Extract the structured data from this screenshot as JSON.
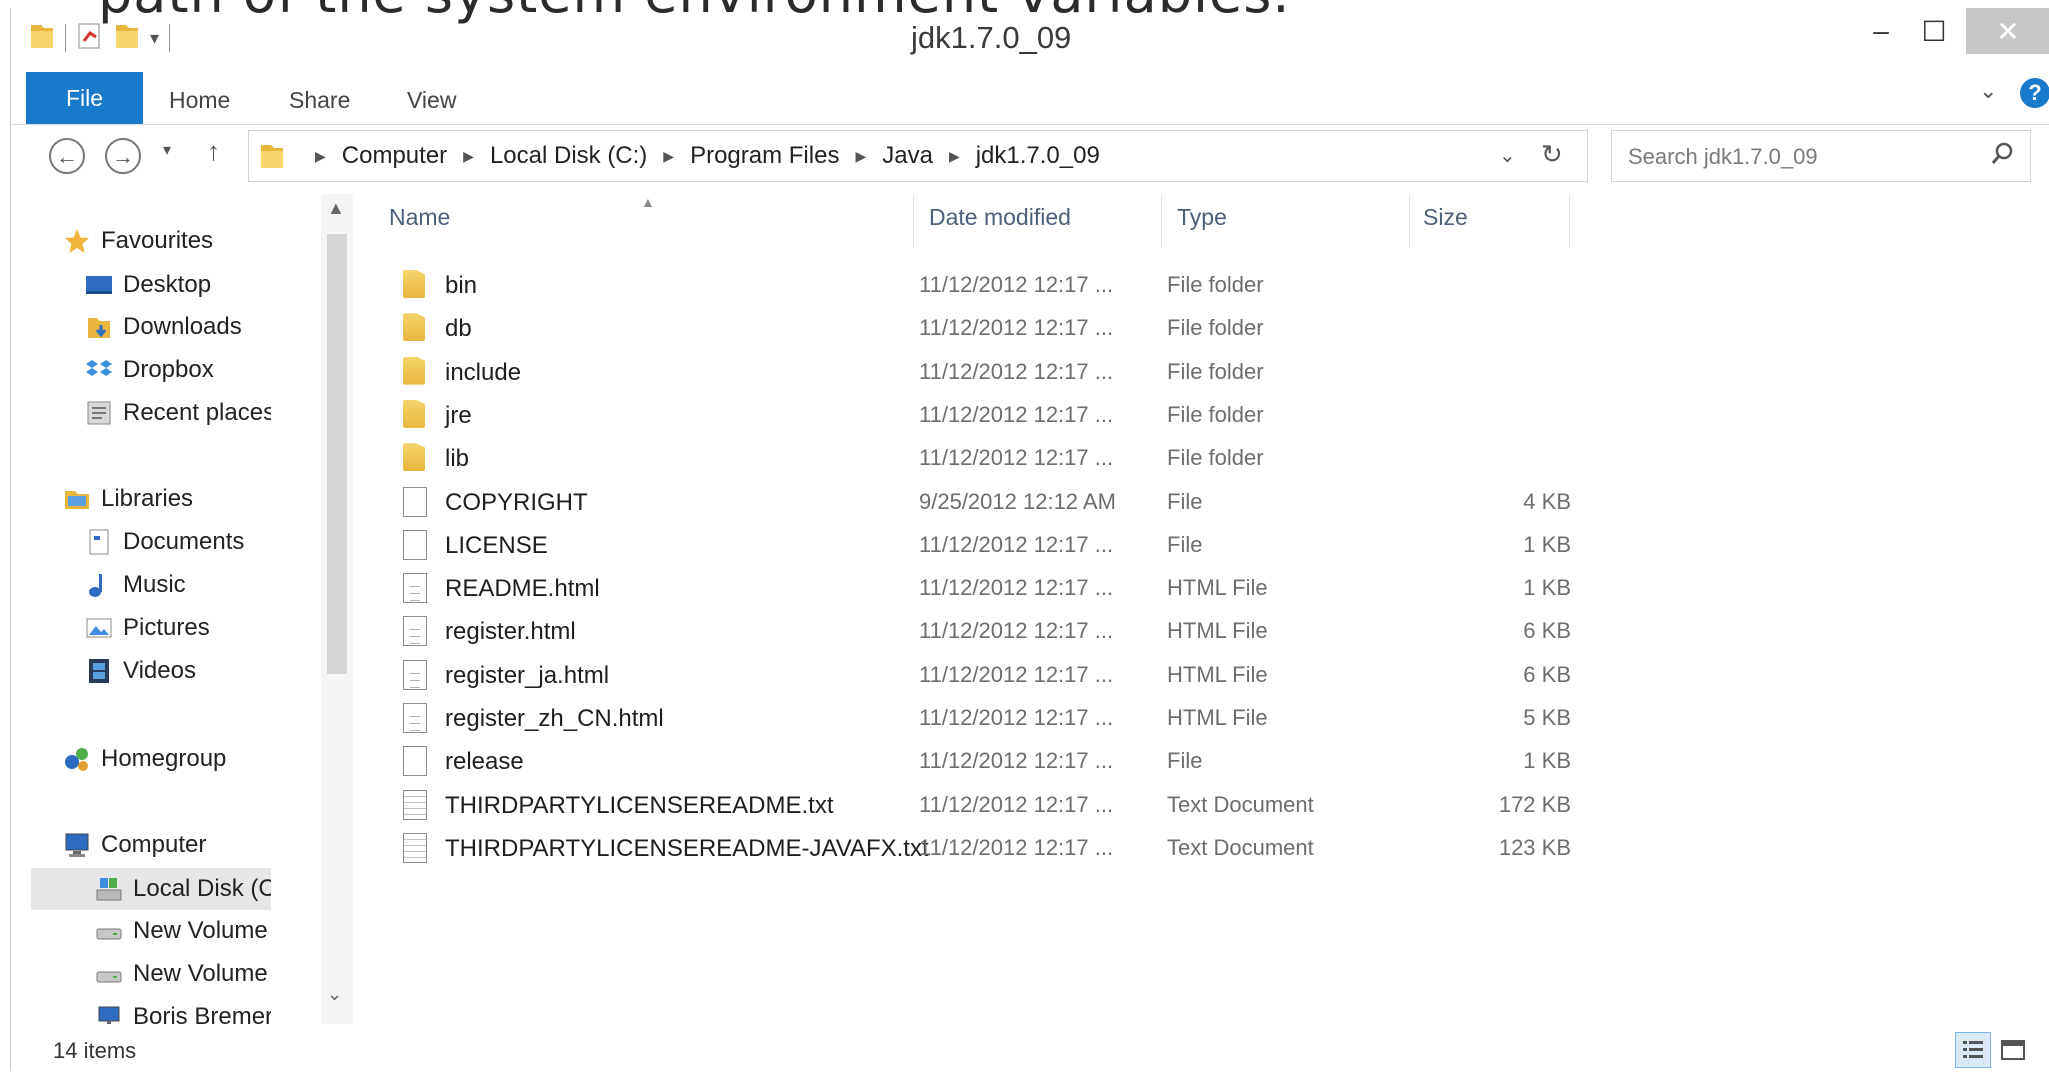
{
  "slide_text": "path of  the system environment variables.",
  "window": {
    "title": "jdk1.7.0_09",
    "min_glyph": "–",
    "max_glyph": "☐",
    "close_glyph": "✕"
  },
  "ribbon": {
    "tabs": [
      "File",
      "Home",
      "Share",
      "View"
    ],
    "help_glyph": "?"
  },
  "address": {
    "crumbs": [
      "Computer",
      "Local Disk (C:)",
      "Program Files",
      "Java",
      "jdk1.7.0_09"
    ],
    "search_placeholder": "Search jdk1.7.0_09"
  },
  "nav": {
    "items": [
      {
        "label": "Favourites",
        "icon": "star-icon"
      },
      {
        "label": "Desktop",
        "icon": "desktop-icon"
      },
      {
        "label": "Downloads",
        "icon": "downloads-icon"
      },
      {
        "label": "Dropbox",
        "icon": "dropbox-icon"
      },
      {
        "label": "Recent places",
        "icon": "recent-places-icon"
      },
      {
        "label": "Libraries",
        "icon": "libraries-icon"
      },
      {
        "label": "Documents",
        "icon": "documents-icon"
      },
      {
        "label": "Music",
        "icon": "music-icon"
      },
      {
        "label": "Pictures",
        "icon": "pictures-icon"
      },
      {
        "label": "Videos",
        "icon": "videos-icon"
      },
      {
        "label": "Homegroup",
        "icon": "homegroup-icon"
      },
      {
        "label": "Computer",
        "icon": "computer-icon"
      },
      {
        "label": "Local Disk (C:)",
        "icon": "local-disk-icon"
      },
      {
        "label": "New Volume (E:)",
        "icon": "drive-icon"
      },
      {
        "label": "New Volume (F:)",
        "icon": "drive-icon"
      },
      {
        "label": "Boris Bremer (de…",
        "icon": "network-drive-icon"
      }
    ],
    "selected": "Local Disk (C:)"
  },
  "columns": [
    "Name",
    "Date modified",
    "Type",
    "Size"
  ],
  "files": [
    {
      "name": "bin",
      "date": "11/12/2012 12:17 ...",
      "type": "File folder",
      "size": "",
      "icon": "folder-icon"
    },
    {
      "name": "db",
      "date": "11/12/2012 12:17 ...",
      "type": "File folder",
      "size": "",
      "icon": "folder-icon"
    },
    {
      "name": "include",
      "date": "11/12/2012 12:17 ...",
      "type": "File folder",
      "size": "",
      "icon": "folder-icon"
    },
    {
      "name": "jre",
      "date": "11/12/2012 12:17 ...",
      "type": "File folder",
      "size": "",
      "icon": "folder-icon"
    },
    {
      "name": "lib",
      "date": "11/12/2012 12:17 ...",
      "type": "File folder",
      "size": "",
      "icon": "folder-icon"
    },
    {
      "name": "COPYRIGHT",
      "date": "9/25/2012 12:12 AM",
      "type": "File",
      "size": "4 KB",
      "icon": "file-icon"
    },
    {
      "name": "LICENSE",
      "date": "11/12/2012 12:17 ...",
      "type": "File",
      "size": "1 KB",
      "icon": "file-icon"
    },
    {
      "name": "README.html",
      "date": "11/12/2012 12:17 ...",
      "type": "HTML File",
      "size": "1 KB",
      "icon": "html-file-icon"
    },
    {
      "name": "register.html",
      "date": "11/12/2012 12:17 ...",
      "type": "HTML File",
      "size": "6 KB",
      "icon": "html-file-icon"
    },
    {
      "name": "register_ja.html",
      "date": "11/12/2012 12:17 ...",
      "type": "HTML File",
      "size": "6 KB",
      "icon": "html-file-icon"
    },
    {
      "name": "register_zh_CN.html",
      "date": "11/12/2012 12:17 ...",
      "type": "HTML File",
      "size": "5 KB",
      "icon": "html-file-icon"
    },
    {
      "name": "release",
      "date": "11/12/2012 12:17 ...",
      "type": "File",
      "size": "1 KB",
      "icon": "file-icon"
    },
    {
      "name": "THIRDPARTYLICENSEREADME.txt",
      "date": "11/12/2012 12:17 ...",
      "type": "Text Document",
      "size": "172 KB",
      "icon": "text-file-icon"
    },
    {
      "name": "THIRDPARTYLICENSEREADME-JAVAFX.txt",
      "date": "11/12/2012 12:17 ...",
      "type": "Text Document",
      "size": "123 KB",
      "icon": "text-file-icon"
    }
  ],
  "status": {
    "item_count": "14 items"
  }
}
